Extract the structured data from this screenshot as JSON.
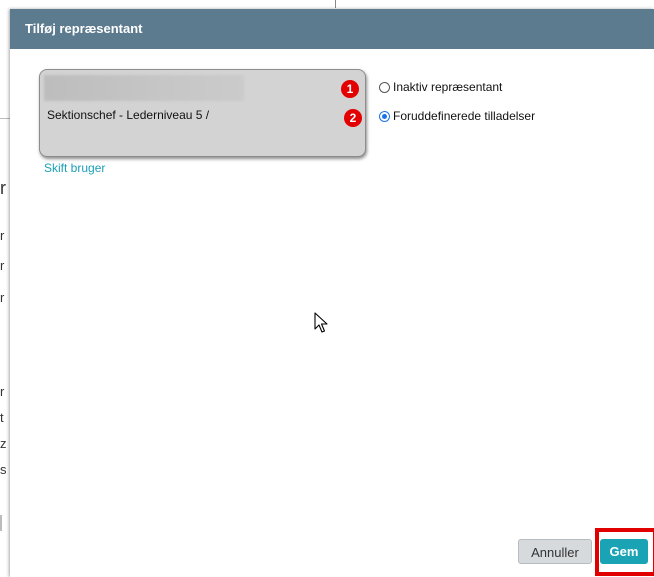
{
  "background": {
    "fragments": [
      "r",
      "r",
      "r",
      "r",
      "r",
      "t",
      "z",
      "s"
    ]
  },
  "dialog": {
    "title": "Tilføj repræsentant",
    "user_card": {
      "role": "Sektionschef - Lederniveau 5 /"
    },
    "switch_user_label": "Skift bruger",
    "options": [
      {
        "badge": "1",
        "label": "Inaktiv repræsentant",
        "selected": false
      },
      {
        "badge": "2",
        "label": "Foruddefinerede tilladelser",
        "selected": true
      }
    ],
    "buttons": {
      "cancel": "Annuller",
      "save": "Gem"
    }
  },
  "colors": {
    "header": "#5d7b8e",
    "link": "#1a9fb5",
    "save_button": "#1aa3b5",
    "badge": "#e30000",
    "highlight": "#e00000"
  }
}
